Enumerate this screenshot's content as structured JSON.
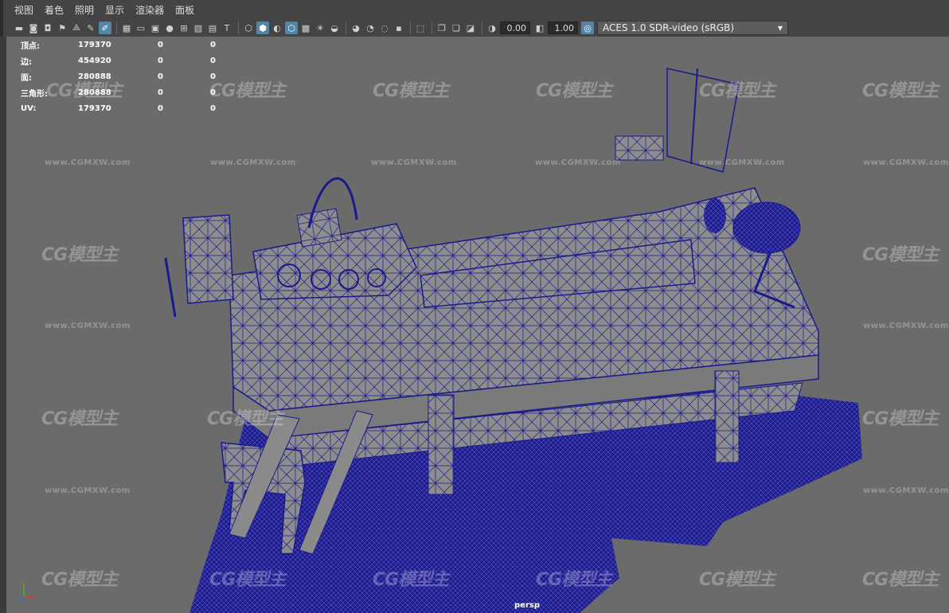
{
  "menu": [
    "视图",
    "着色",
    "照明",
    "显示",
    "渲染器",
    "面板"
  ],
  "toolbar": {
    "exposure_value": "0.00",
    "gamma_value": "1.00",
    "color_space": "ACES 1.0 SDR-video (sRGB)"
  },
  "hud": {
    "rows": [
      {
        "label": "顶点:",
        "v1": "179370",
        "v2": "0",
        "v3": "0"
      },
      {
        "label": "边:",
        "v1": "454920",
        "v2": "0",
        "v3": "0"
      },
      {
        "label": "面:",
        "v1": "280888",
        "v2": "0",
        "v3": "0"
      },
      {
        "label": "三角形:",
        "v1": "280888",
        "v2": "0",
        "v3": "0"
      },
      {
        "label": "UV:",
        "v1": "179370",
        "v2": "0",
        "v3": "0"
      }
    ]
  },
  "camera_label": "persp",
  "watermark": {
    "logo": "CG模型主",
    "url": "www.CGMXW.com"
  },
  "colors": {
    "wire": "#1a1a8c",
    "mesh": "#8c8c8c",
    "bg": "#6b6b6b",
    "accent": "#5285a6"
  }
}
